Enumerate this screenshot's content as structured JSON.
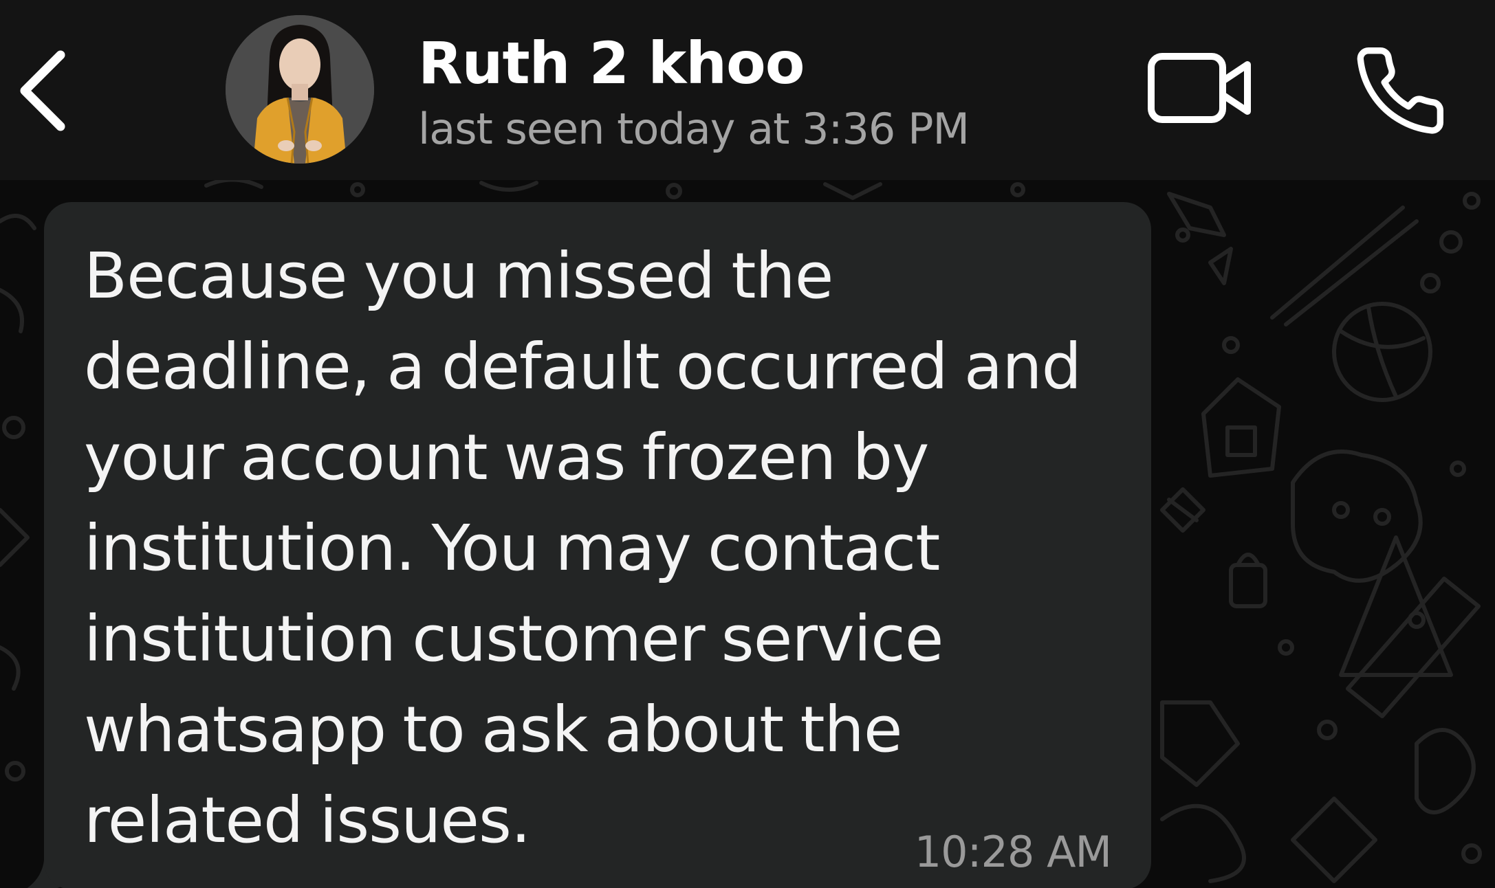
{
  "header": {
    "contact_name": "Ruth 2 khoo",
    "last_seen": "last seen today at 3:36 PM",
    "back_icon": "chevron-left-icon",
    "video_icon": "video-camera-icon",
    "call_icon": "phone-icon"
  },
  "message": {
    "lines": [
      "Because you missed the",
      "deadline, a default occurred and",
      "your account was frozen by",
      "institution. You may contact",
      "institution customer service",
      "whatsapp to ask about the",
      "related issues."
    ],
    "time": "10:28 AM"
  },
  "colors": {
    "header_bg": "#141414",
    "chat_bg": "#0b0b0b",
    "bubble_bg": "#232525",
    "text_primary": "#ffffff",
    "text_secondary": "#a4a4a4"
  }
}
